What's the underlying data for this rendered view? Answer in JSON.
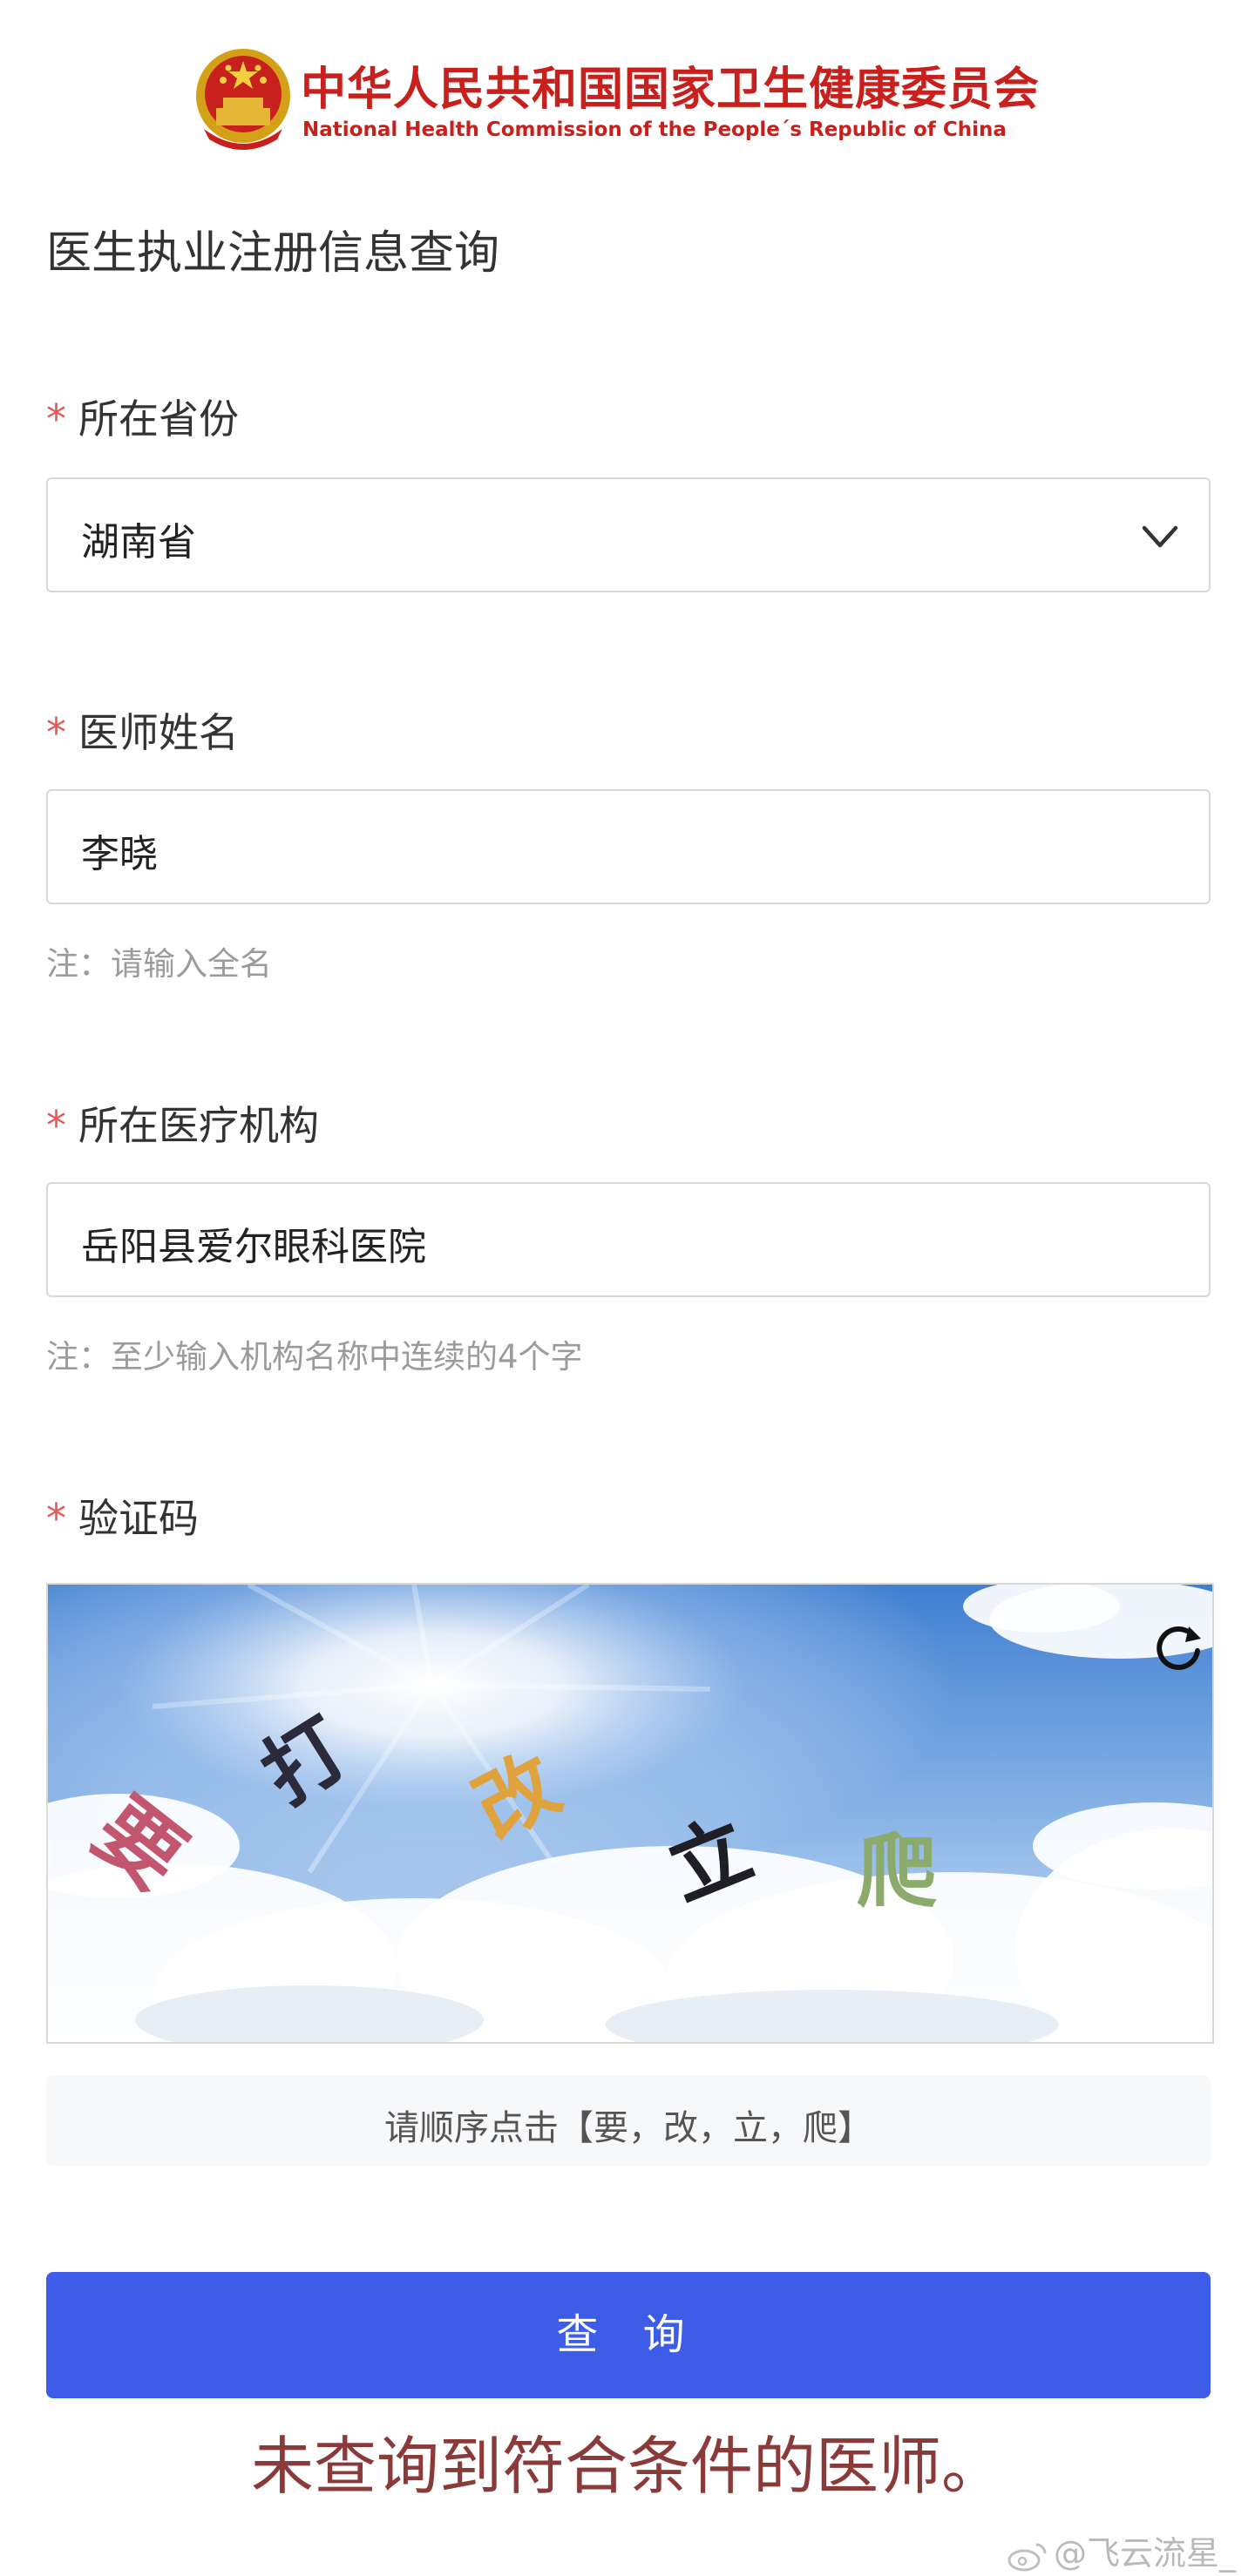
{
  "header": {
    "org_cn": "中华人民共和国国家卫生健康委员会",
    "org_en": "National Health Commission of the People´s Republic of China",
    "emblem_icon": "national-emblem-icon"
  },
  "page_title": "医生执业注册信息查询",
  "form": {
    "required_mark": "*",
    "province": {
      "label": "所在省份",
      "value": "湖南省"
    },
    "doctor_name": {
      "label": "医师姓名",
      "value": "李晓",
      "note": "注：请输入全名"
    },
    "institution": {
      "label": "所在医疗机构",
      "value": "岳阳县爱尔眼科医院",
      "note": "注：至少输入机构名称中连续的4个字"
    },
    "captcha": {
      "label": "验证码",
      "chars": [
        "要",
        "打",
        "改",
        "立",
        "爬"
      ],
      "char_colors": [
        "#c2566e",
        "#2a2a3a",
        "#e0a23c",
        "#1e1e24",
        "#8caa6c"
      ],
      "refresh_icon": "refresh-icon",
      "hint": "请顺序点击【要，改，立，爬】"
    }
  },
  "query_button": "查 询",
  "result_message": "未查询到符合条件的医师。",
  "watermark": "@飞云流星_",
  "colors": {
    "accent": "#3d5ce8",
    "required": "#e85757",
    "brand_red": "#c8201d",
    "result_text": "#8b3a3a"
  }
}
